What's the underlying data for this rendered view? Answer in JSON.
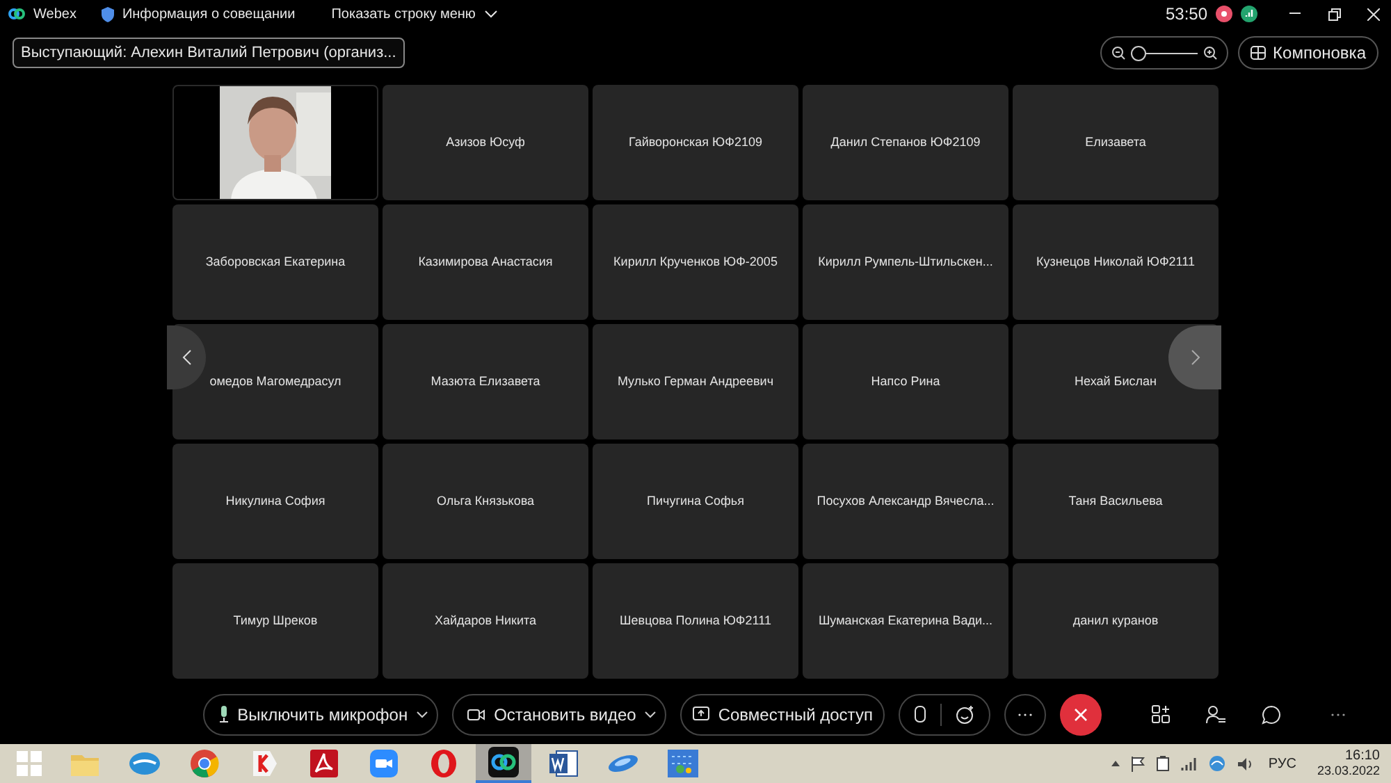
{
  "title_bar": {
    "app": "Webex",
    "meeting_info": "Информация о совещании",
    "show_menu": "Показать строку меню",
    "timer": "53:50"
  },
  "presenter": "Выступающий: Алехин Виталий Петрович (организ...",
  "layout_button": "Компоновка",
  "zoom": {
    "level": 0.1
  },
  "tiles": [
    {
      "kind": "picture"
    },
    {
      "kind": "name",
      "name": "Азизов Юсуф"
    },
    {
      "kind": "name",
      "name": "Гайворонская ЮФ2109"
    },
    {
      "kind": "name",
      "name": "Данил Степанов ЮФ2109"
    },
    {
      "kind": "name",
      "name": "Елизавета"
    },
    {
      "kind": "name",
      "name": "Заборовская Екатерина"
    },
    {
      "kind": "name",
      "name": "Казимирова Анастасия"
    },
    {
      "kind": "name",
      "name": "Кирилл Крученков ЮФ-2005"
    },
    {
      "kind": "name",
      "name": "Кирилл Румпель-Штильскен..."
    },
    {
      "kind": "name",
      "name": "Кузнецов Николай ЮФ2111"
    },
    {
      "kind": "name",
      "name": "омедов Магомедрасул"
    },
    {
      "kind": "name",
      "name": "Мазюта Елизавета"
    },
    {
      "kind": "name",
      "name": "Мулько Герман Андреевич"
    },
    {
      "kind": "name",
      "name": "Напсо Рина"
    },
    {
      "kind": "name",
      "name": "Нехай Бислан"
    },
    {
      "kind": "name",
      "name": "Никулина София"
    },
    {
      "kind": "name",
      "name": "Ольга Князькова"
    },
    {
      "kind": "name",
      "name": "Пичугина Софья"
    },
    {
      "kind": "name",
      "name": "Посухов Александр Вячесла..."
    },
    {
      "kind": "name",
      "name": "Таня Васильева"
    },
    {
      "kind": "name",
      "name": "Тимур Шреков"
    },
    {
      "kind": "name",
      "name": "Хайдаров Никита"
    },
    {
      "kind": "name",
      "name": "Шевцова Полина ЮФ2111"
    },
    {
      "kind": "name",
      "name": "Шуманская Екатерина Вади..."
    },
    {
      "kind": "name",
      "name": "данил куранов"
    }
  ],
  "controls": {
    "mute": "Выключить микрофон",
    "video": "Остановить видео",
    "share": "Совместный доступ"
  },
  "taskbar": {
    "apps": [
      {
        "kind": "folder",
        "active": false
      },
      {
        "kind": "cloud",
        "active": false
      },
      {
        "kind": "chrome",
        "active": false
      },
      {
        "kind": "yandex",
        "active": false
      },
      {
        "kind": "pdf",
        "active": false
      },
      {
        "kind": "camera",
        "active": false
      },
      {
        "kind": "opera",
        "active": false
      },
      {
        "kind": "webex",
        "active": true
      },
      {
        "kind": "word",
        "active": false
      },
      {
        "kind": "disc",
        "active": false
      },
      {
        "kind": "map",
        "active": false
      }
    ],
    "language": "РУС",
    "time": "16:10",
    "date": "23.03.2022"
  }
}
